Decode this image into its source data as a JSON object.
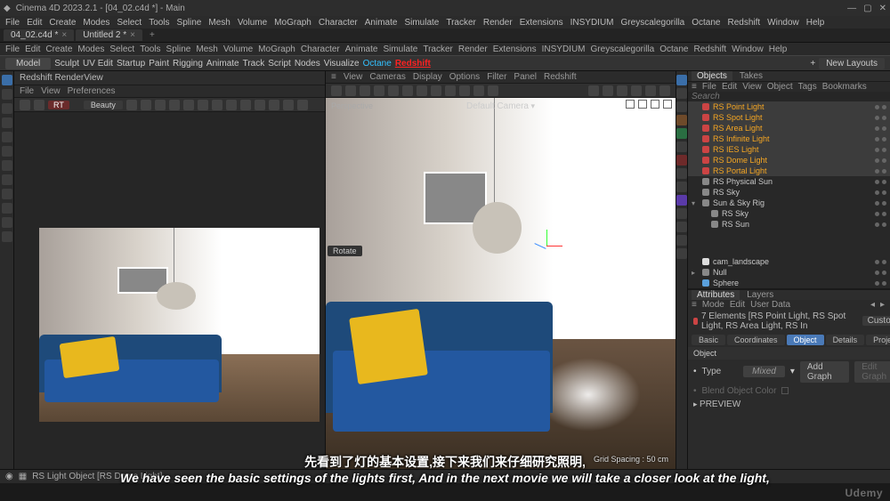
{
  "titlebar": {
    "app_title": "Cinema 4D 2023.2.1 - [04_02.c4d *] - Main",
    "min": "—",
    "max": "▢",
    "close": "✕"
  },
  "menubar": [
    "File",
    "Edit",
    "Create",
    "Modes",
    "Select",
    "Tools",
    "Spline",
    "Mesh",
    "Volume",
    "MoGraph",
    "Character",
    "Animate",
    "Simulate",
    "Tracker",
    "Render",
    "Extensions",
    "INSYDIUM",
    "Greyscalegorilla",
    "Octane",
    "Redshift",
    "Window",
    "Help"
  ],
  "tabs": {
    "t1": "04_02.c4d *",
    "t2": "Untitled 2 *",
    "plus": "+"
  },
  "menubar2": [
    "File",
    "Edit",
    "Create",
    "Modes",
    "Select",
    "Tools",
    "Spline",
    "Mesh",
    "Volume",
    "MoGraph",
    "Character",
    "Animate",
    "Simulate",
    "Tracker",
    "Render",
    "Extensions",
    "INSYDIUM",
    "Greyscalegorilla",
    "Octane",
    "Redshift",
    "Window",
    "Help"
  ],
  "toolbar_top": {
    "modes": [
      "Model",
      "Sculpt",
      "UV Edit",
      "Startup",
      "Paint",
      "Rigging",
      "Animate",
      "Track",
      "Script",
      "Nodes",
      "Visualize",
      "Octane",
      "Redshift"
    ],
    "new_layouts": "New Layouts",
    "plus": "+"
  },
  "render_view": {
    "title": "Redshift RenderView",
    "submenu": [
      "File",
      "View",
      "Preferences"
    ],
    "rt_label": "RT",
    "drop": "Beauty"
  },
  "viewport": {
    "submenu": [
      "≡",
      "View",
      "Cameras",
      "Display",
      "Options",
      "Filter",
      "Panel",
      "Redshift"
    ],
    "label": "Perspective",
    "camera": "Default Camera",
    "grid": "Grid Spacing : 50 cm",
    "rotate": "Rotate"
  },
  "objects_panel": {
    "tabs": {
      "a": "Objects",
      "b": "Takes"
    },
    "menu": [
      "≡",
      "File",
      "Edit",
      "View",
      "Object",
      "Tags",
      "Bookmarks"
    ],
    "search": "Search",
    "items": [
      {
        "name": "RS Point Light",
        "on": true,
        "sel": true,
        "chk": false
      },
      {
        "name": "RS Spot Light",
        "on": true,
        "sel": true,
        "chk": false
      },
      {
        "name": "RS Area Light",
        "on": true,
        "sel": true,
        "chk": false
      },
      {
        "name": "RS Infinite Light",
        "on": true,
        "sel": true,
        "chk": false
      },
      {
        "name": "RS IES Light",
        "on": true,
        "sel": true,
        "chk": false
      },
      {
        "name": "RS Dome Light",
        "on": true,
        "sel": true,
        "chk": false
      },
      {
        "name": "RS Portal Light",
        "on": true,
        "sel": true,
        "chk": true
      }
    ],
    "items2": [
      {
        "name": "RS Physical Sun",
        "cls": "gry"
      },
      {
        "name": "RS Sky",
        "cls": "gry"
      },
      {
        "name": "Sun & Sky Rig",
        "cls": "gry",
        "exp": true
      },
      {
        "name": "RS Sky",
        "cls": "gry",
        "indent": 1
      },
      {
        "name": "RS Sun",
        "cls": "gry",
        "indent": 1
      }
    ],
    "items3": [
      {
        "name": "cam_landscape",
        "cls": "wht"
      },
      {
        "name": "Null",
        "cls": "gry",
        "exp": false
      },
      {
        "name": "Sphere",
        "cls": "blu"
      }
    ]
  },
  "attributes": {
    "tabs": {
      "a": "Attributes",
      "b": "Layers"
    },
    "menu": [
      "≡",
      "Mode",
      "Edit",
      "User Data"
    ],
    "info": "7 Elements [RS Point Light, RS Spot Light, RS Area Light, RS In",
    "info_mode": "Custom",
    "attr_tabs": [
      "Basic",
      "Coordinates",
      "Object",
      "Details",
      "Project"
    ],
    "section": "Object",
    "type_lbl": "Type",
    "type_val": "Mixed",
    "addg": "Add Graph",
    "editg": "Edit Graph",
    "blend_lbl": "Blend Object Color",
    "preview": "PREVIEW"
  },
  "status": {
    "left": "RS Light Object [RS Dome Light]",
    "watermark": "Udemy"
  },
  "subtitles": {
    "cn": "先看到了灯的基本设置,接下来我们来仔细研究照明,",
    "en": "We have seen the basic settings of the lights first, And in the next movie we will take a closer look at the light,"
  }
}
